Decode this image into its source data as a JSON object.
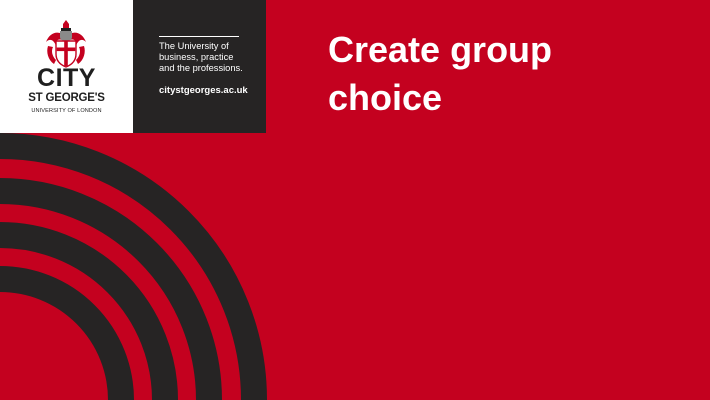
{
  "logo": {
    "name": "CITY",
    "subname": "ST GEORGE'S",
    "university": "UNIVERSITY OF LONDON",
    "crest_icon": "city-crest-icon"
  },
  "tagline": {
    "text": "The University of\nbusiness, practice\nand the professions.",
    "url": "citystgeorges.ac.uk"
  },
  "slide": {
    "title": "Create group\nchoice"
  },
  "colors": {
    "background": "#c4011f",
    "logo_panel": "#ffffff",
    "tagline_panel": "#262424",
    "arcs": "#262424",
    "crest_red": "#c4011f",
    "text_light": "#ffffff",
    "text_dark": "#1f1f1f"
  }
}
